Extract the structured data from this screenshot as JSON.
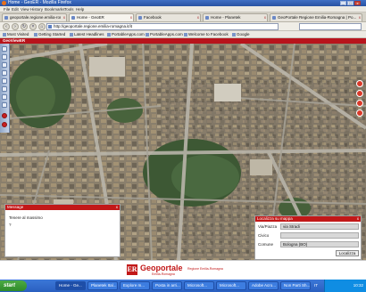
{
  "window": {
    "title": "Home - GeoER - Mozilla Firefox",
    "controls": [
      "minimize",
      "maximize",
      "close"
    ]
  },
  "menu": [
    "File",
    "Edit",
    "View",
    "History",
    "Bookmarks",
    "Tools",
    "Help"
  ],
  "tabs": [
    {
      "label": "geoportale.regione.emilia-romagna - Cerca",
      "active": false
    },
    {
      "label": "Home - GeoER",
      "active": true
    },
    {
      "label": "Facebook",
      "active": false
    },
    {
      "label": "Home - Planetek",
      "active": false
    },
    {
      "label": "GeoPortale Regione Emilia-Romagna | Po...",
      "active": false
    }
  ],
  "nav": {
    "url": "http://geoportale.regione.emilia-romagna.it/it"
  },
  "bookmarks": [
    "Most Visited",
    "Getting Started",
    "Latest Headlines",
    "PortableApps.com",
    "PortableApps.com",
    "Welcome to Facebook",
    "Google"
  ],
  "app": {
    "header": "GeoViewER",
    "left_tools": [
      "home-icon",
      "pan-icon",
      "zoom-in-icon",
      "zoom-out-icon",
      "layers-icon",
      "measure-icon",
      "info-icon",
      "select-icon",
      "print-icon",
      "clear-icon"
    ],
    "right_tools": [
      "compass-icon",
      "zoom-in-icon",
      "zoom-out-icon",
      "rotate-icon"
    ],
    "message_panel": {
      "title": "Message",
      "close": "x",
      "line1": "Tenere al massimo",
      "line2": "?"
    },
    "locate_panel": {
      "title": "Localizza su mappa",
      "close": "x",
      "fields": [
        {
          "label": "Via/Piazza",
          "value": "via Stradi"
        },
        {
          "label": "Civico",
          "value": ""
        },
        {
          "label": "Comune",
          "value": "Bologna (BO)"
        }
      ],
      "button": "Localizza"
    }
  },
  "footer": {
    "logo_letters": "ER",
    "name": "Geoportale",
    "sub": "Emilia-Romagna",
    "right_text": "Regione Emilia-Romagna"
  },
  "taskbar": {
    "start": "start",
    "tasks": [
      {
        "label": "Home - Ge...",
        "active": true
      },
      {
        "label": "Planetek Ital...",
        "active": false
      },
      {
        "label": "Explore m...",
        "active": false
      },
      {
        "label": "Posta in arri...",
        "active": false
      },
      {
        "label": "Microsoft...",
        "active": false
      },
      {
        "label": "Microsoft...",
        "active": false
      },
      {
        "label": "Adobe Acro...",
        "active": false
      },
      {
        "label": "Non Parti Sh...",
        "active": false
      }
    ],
    "lang": "IT",
    "clock": "10:32"
  },
  "colors": {
    "accent_red": "#c21818",
    "taskbar_blue": "#2a5fc0"
  }
}
